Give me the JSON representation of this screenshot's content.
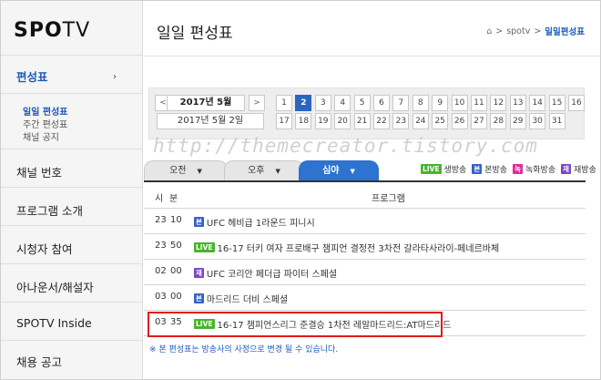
{
  "logo": {
    "spo": "SPO",
    "tv": "TV"
  },
  "sidebar": {
    "sections": [
      {
        "label": "편성표",
        "active": true
      },
      {
        "label": "채널 번호"
      },
      {
        "label": "프로그램 소개"
      },
      {
        "label": "시청자 참여"
      },
      {
        "label": "아나운서/해설자"
      },
      {
        "label": "SPOTV Inside"
      },
      {
        "label": "채용 공고"
      }
    ],
    "sub_items": [
      "일일 편성표",
      "주간 편성표",
      "채널 공지"
    ],
    "chevron": "›"
  },
  "header": {
    "title": "일일 편성표",
    "breadcrumb": {
      "home_icon": "⌂",
      "sep": ">",
      "spotv": "spotv",
      "current": "일일편성표"
    }
  },
  "date": {
    "prev": "<",
    "next": ">",
    "month": "2017년 5월",
    "full_date": "2017년 5월 2일",
    "selected_day": "2",
    "days_row1": [
      "1",
      "2",
      "3",
      "4",
      "5",
      "6",
      "7",
      "8",
      "9",
      "10",
      "11",
      "12",
      "13",
      "14",
      "15",
      "16"
    ],
    "days_row2": [
      "17",
      "18",
      "19",
      "20",
      "21",
      "22",
      "23",
      "24",
      "25",
      "26",
      "27",
      "28",
      "29",
      "30",
      "31"
    ]
  },
  "watermark": "http://themecreator.tistory.com",
  "tabs": [
    {
      "label": "오전",
      "caret": "▼"
    },
    {
      "label": "오후",
      "caret": "▼"
    },
    {
      "label": "심야",
      "caret": "▼",
      "active": true
    }
  ],
  "legend": [
    {
      "badge": "LIVE",
      "label": "생방송",
      "type": "live"
    },
    {
      "badge": "본",
      "label": "본방송",
      "type": "bon"
    },
    {
      "badge": "녹",
      "label": "녹화방송",
      "type": "rec"
    },
    {
      "badge": "재",
      "label": "재방송",
      "type": "re"
    }
  ],
  "table": {
    "col_hour": "시",
    "col_min": "분",
    "col_program": "프로그램",
    "rows": [
      {
        "hour": "23",
        "min": "10",
        "badge": "본",
        "type": "bon",
        "title": "UFC 헤비급 1라운드 피니시"
      },
      {
        "hour": "23",
        "min": "50",
        "badge": "LIVE",
        "type": "live",
        "title": "16-17 터키 여자 프로배구 챔피언 결정전 3차전 갈라타사라이-페네르바체"
      },
      {
        "hour": "02",
        "min": "00",
        "badge": "재",
        "type": "re",
        "title": "UFC 코리안 페더급 파이터 스페셜"
      },
      {
        "hour": "03",
        "min": "00",
        "badge": "본",
        "type": "bon",
        "title": "마드리드 더비 스페셜"
      },
      {
        "hour": "03",
        "min": "35",
        "badge": "LIVE",
        "type": "live",
        "title": "16-17 챔피언스리그 준결승 1차전 레알마드리드:AT마드리드"
      }
    ]
  },
  "note": "※ 본 편성표는 방송사의 사정으로 변경 될 수 있습니다.",
  "colors": {
    "accent": "#2d73cf",
    "highlight": "#e01b1b",
    "live": "#4ab32e",
    "bon": "#3662c8",
    "rec": "#e02b9b",
    "re": "#7a46c4"
  }
}
